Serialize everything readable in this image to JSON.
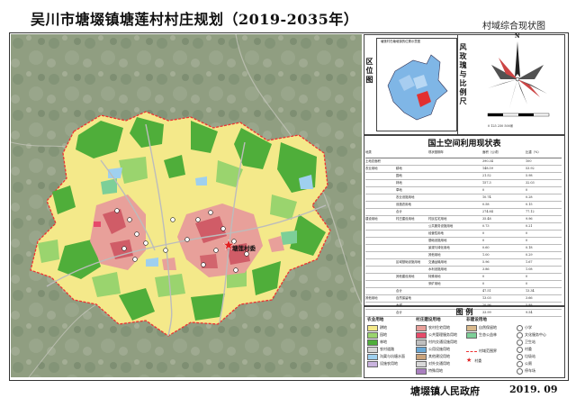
{
  "header": {
    "title": "吴川市塘㙍镇塘莲村村庄规划（2019-2035年）",
    "subtitle": "村域综合现状图"
  },
  "location": {
    "label": "区位图",
    "map_caption": "塘莲村在塘㙍镇的位置示意图",
    "compass_label": "N",
    "rose_label": "风玫瑰与比例尺",
    "scale_text": "0   125  250     500米"
  },
  "map": {
    "village_label": "塘莲村委"
  },
  "land_table": {
    "title": "国土空间利用现状表",
    "headers": [
      "地类",
      "",
      "现状基期年",
      "面积（公顷）",
      "比重（%）"
    ],
    "rows": [
      [
        "土地总面积",
        "",
        "",
        "390.34",
        "100"
      ],
      [
        "农业用地",
        "耕地",
        "",
        "148.59",
        "53.92"
      ],
      [
        "",
        "园地",
        "",
        "21.52",
        "5.98"
      ],
      [
        "",
        "林地",
        "",
        "157.3",
        "32.03"
      ],
      [
        "",
        "草地",
        "",
        "0",
        "0"
      ],
      [
        "",
        "农业设施用地",
        "",
        "10.74",
        "0.28"
      ],
      [
        "",
        "设施农用地",
        "",
        "0.58",
        "0.15"
      ],
      [
        "",
        "合计",
        "",
        "274.84",
        "77.12"
      ],
      [
        "建设用地",
        "村庄建设用地",
        "村民住宅用地",
        "35.48",
        "9.96"
      ],
      [
        "",
        "",
        "公共服务设施用地",
        "0.73",
        "0.21"
      ],
      [
        "",
        "",
        "经营性用地",
        "0",
        "0"
      ],
      [
        "",
        "",
        "基础设施用地",
        "0",
        "0"
      ],
      [
        "",
        "",
        "景观与绿化用地",
        "0.60",
        "0.18"
      ],
      [
        "",
        "",
        "其他用地",
        "1.00",
        "0.29"
      ],
      [
        "",
        "区域基础设施用地",
        "交通运输用地",
        "5.96",
        "1.67"
      ],
      [
        "",
        "",
        "水利设施用地",
        "3.86",
        "1.08"
      ],
      [
        "",
        "其他建设用地",
        "特殊用地",
        "0",
        "0"
      ],
      [
        "",
        "",
        "采矿用地",
        "0",
        "0"
      ],
      [
        "",
        "合计",
        "",
        "47.51",
        "13.34"
      ],
      [
        "其他用地",
        "自然保留地",
        "",
        "13.03",
        "3.66"
      ],
      [
        "",
        "水域",
        "",
        "20.96",
        "5.88"
      ],
      [
        "",
        "合计",
        "",
        "33.99",
        "9.54"
      ]
    ]
  },
  "legend": {
    "title": "图  例",
    "columns": [
      {
        "head": "农业用地",
        "items": [
          {
            "label": "耕地",
            "color": "#f4e98a"
          },
          {
            "label": "园地",
            "color": "#9ad46e"
          },
          {
            "label": "林地",
            "color": "#4fae3a"
          },
          {
            "label": "农村道路",
            "color": "#d7d7d7"
          },
          {
            "label": "沟渠与坑塘水面",
            "color": "#9fd0ef"
          },
          {
            "label": "设施农用地",
            "color": "#c9b3de"
          }
        ]
      },
      {
        "head": "村庄建设用地",
        "items": [
          {
            "label": "农村住宅用地",
            "color": "#e8a09a"
          },
          {
            "label": "公共管理服务用地",
            "color": "#e64b6a"
          },
          {
            "label": "村内交通设施用地",
            "color": "#bfbfbf"
          },
          {
            "label": "公用设施用地",
            "color": "#6aa9d6"
          },
          {
            "label": "其他建设用地",
            "color": "#c9a27a"
          },
          {
            "label": "对外交通用地",
            "color": "#d8d8d8"
          },
          {
            "label": "特殊用地",
            "color": "#a97fbf"
          }
        ]
      },
      {
        "head": "非建设用地",
        "items": [
          {
            "label": "自然保留地",
            "color": "#d9b98c"
          },
          {
            "label": "生态公益林",
            "color": "#7dcf98"
          }
        ]
      },
      {
        "head": "",
        "items": [
          {
            "label": "小学",
            "color": "#ffffff"
          },
          {
            "label": "文化服务中心",
            "color": "#ffffff"
          },
          {
            "label": "卫生站",
            "color": "#ffffff"
          },
          {
            "label": "村委",
            "color": "#ffffff"
          },
          {
            "label": "垃圾站",
            "color": "#ffffff"
          },
          {
            "label": "公厕",
            "color": "#ffffff"
          },
          {
            "label": "停车场",
            "color": "#ffffff"
          }
        ]
      }
    ],
    "boundary_label": "村域范围界",
    "village_marker_label": "村委"
  },
  "footer": {
    "org": "塘㙍镇人民政府",
    "date": "2019. 09"
  }
}
